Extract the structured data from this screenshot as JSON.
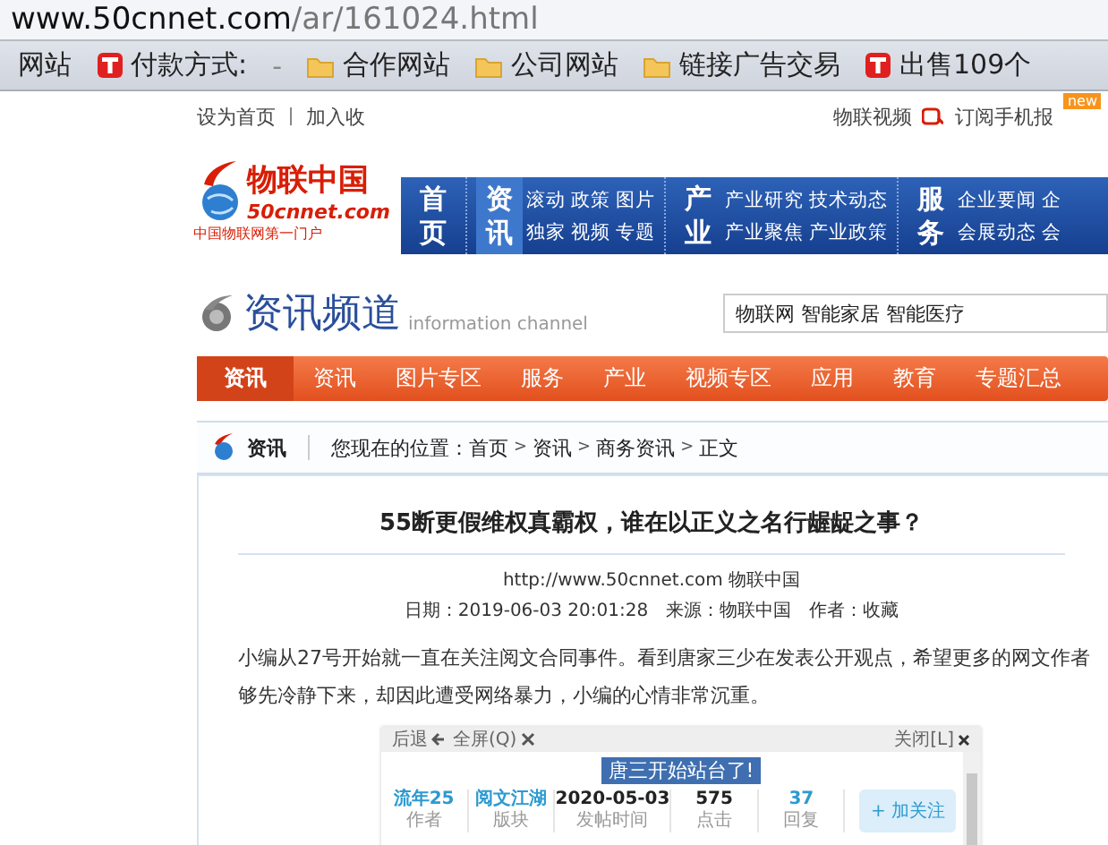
{
  "address_bar": {
    "host": "www.50cnnet.com",
    "path": "/ar/161024.html"
  },
  "bookmarks": [
    {
      "kind": "plain",
      "label": "网站"
    },
    {
      "kind": "site",
      "label": "付款方式:"
    },
    {
      "kind": "plain",
      "label": "-"
    },
    {
      "kind": "folder",
      "label": "合作网站"
    },
    {
      "kind": "folder",
      "label": "公司网站"
    },
    {
      "kind": "folder",
      "label": "链接广告交易"
    },
    {
      "kind": "site",
      "label": "出售109个"
    }
  ],
  "top_links": {
    "left": [
      "设为首页",
      "加入收"
    ],
    "right": [
      {
        "label": "物联视频"
      },
      {
        "label": "订阅手机报",
        "badge": "new"
      }
    ]
  },
  "logo": {
    "name": "物联中国",
    "domain": "50cnnet.com",
    "slogan": "中国物联网第一门户"
  },
  "main_nav": [
    {
      "label": "首页",
      "selected": false
    },
    {
      "label": "资讯",
      "selected": true,
      "rows": [
        [
          "滚动",
          "政策",
          "图片"
        ],
        [
          "独家",
          "视频",
          "专题"
        ]
      ]
    },
    {
      "label": "产业",
      "selected": false,
      "rows": [
        [
          "产业研究",
          "技术动态"
        ],
        [
          "产业聚焦",
          "产业政策"
        ]
      ]
    },
    {
      "label": "服务",
      "selected": false,
      "rows": [
        [
          "企业要闻",
          "企"
        ],
        [
          "会展动态",
          "会"
        ]
      ]
    }
  ],
  "channel": {
    "title": "资讯频道",
    "subtitle": "information channel",
    "search": {
      "value": "物联网 智能家居 智能医疗"
    }
  },
  "channel_nav": [
    {
      "label": "资讯",
      "selected": true
    },
    {
      "label": "资讯",
      "selected": false
    },
    {
      "label": "图片专区",
      "selected": false
    },
    {
      "label": "服务",
      "selected": false
    },
    {
      "label": "产业",
      "selected": false
    },
    {
      "label": "视频专区",
      "selected": false
    },
    {
      "label": "应用",
      "selected": false
    },
    {
      "label": "教育",
      "selected": false
    },
    {
      "label": "专题汇总",
      "selected": false
    }
  ],
  "breadcrumb": {
    "section": "资讯",
    "prefix": "您现在的位置：",
    "separator": ">",
    "path": [
      "首页",
      "资讯",
      "商务资讯",
      "正文"
    ]
  },
  "article": {
    "title": "55断更假维权真霸权，谁在以正义之名行龌龊之事？",
    "source": "http://www.50cnnet.com 物联中国",
    "meta": [
      "日期：2019-06-03 20:01:28",
      "来源：物联中国",
      "作者：收藏"
    ],
    "paragraph_lines": [
      "小编从27号开始就一直在关注阅文合同事件。看到唐家三少在发表公开观点，希望更多的网文作者",
      "够先冷静下来，却因此遭受网络暴力，小编的心情非常沉重。"
    ],
    "embedded": {
      "toolbar_left": [
        "后退",
        "全屏(Q)"
      ],
      "toolbar_right": "关闭[L]",
      "title": "唐三开始站台了!",
      "stats": [
        {
          "kind": "link",
          "value": "流年25",
          "label": "作者"
        },
        {
          "kind": "link",
          "value": "阅文江湖",
          "label": "版块"
        },
        {
          "kind": "plain",
          "value": "2020-05-03",
          "label": "发帖时间"
        },
        {
          "kind": "plain",
          "value": "575",
          "label": "点击"
        },
        {
          "kind": "link",
          "value": "37",
          "label": "回复"
        }
      ],
      "follow_button": "+ 加关注"
    }
  }
}
